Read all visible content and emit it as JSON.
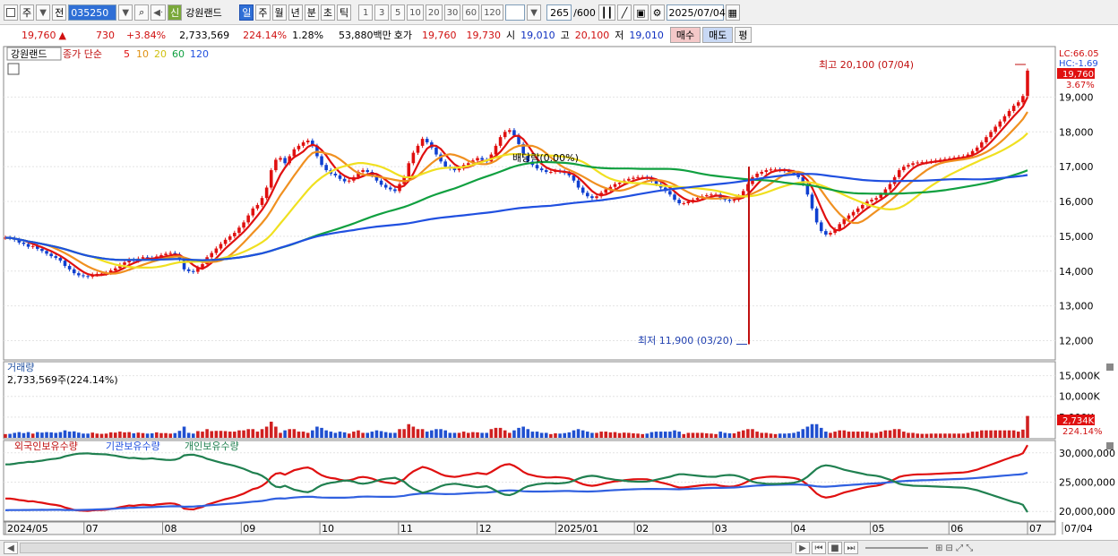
{
  "toolbar": {
    "market_label": "주",
    "prev_label": "전",
    "code": "035250",
    "badge": "신",
    "name": "강원랜드",
    "periods": [
      "일",
      "주",
      "월",
      "년",
      "분",
      "초",
      "틱"
    ],
    "active_period": "일",
    "intervals": [
      "1",
      "3",
      "5",
      "10",
      "20",
      "30",
      "60",
      "120"
    ],
    "count": "265",
    "count_total": "/600",
    "date": "2025/07/04"
  },
  "quote": {
    "price": "19,760",
    "change_arrow": "▲",
    "change": "730",
    "change_pct": "+3.84%",
    "volume": "2,733,569",
    "volume_ratio": "224.14%",
    "turnover": "1.28%",
    "amount": "53,880백만",
    "bid_label": "호가",
    "ask_price": "19,760",
    "bid_price": "19,730",
    "open_label": "시",
    "open": "19,010",
    "high_label": "고",
    "high": "20,100",
    "low_label": "저",
    "low": "19,010",
    "buy_label": "매수",
    "sell_label": "매도",
    "eval_label": "평"
  },
  "chart_data": [
    {
      "type": "candlestick",
      "title_tag": "강원랜드",
      "legend": {
        "label": "종가 단순",
        "periods": [
          "5",
          "10",
          "20",
          "60",
          "120"
        ],
        "colors": [
          "#e01010",
          "#f09020",
          "#f0e020",
          "#10a040",
          "#2050e0"
        ]
      },
      "y_ticks": [
        12000,
        13000,
        14000,
        15000,
        16000,
        17000,
        18000,
        19000
      ],
      "y_tick_labels": [
        "12,000",
        "13,000",
        "14,000",
        "15,000",
        "16,000",
        "17,000",
        "18,000",
        "19,000"
      ],
      "ylim": [
        11500,
        20400
      ],
      "lc_label": "LC:66.05",
      "hc_label": "HC:-1.69",
      "last_price_label": "19,760",
      "last_change_label": "3.67%",
      "high_annotation": "최고 20,100 (07/04)",
      "low_annotation": "최저 11,900 (03/20)",
      "event_annotation": "배당락(0.00%)",
      "close_series": [
        14960,
        14950,
        14900,
        14820,
        14780,
        14700,
        14720,
        14640,
        14580,
        14500,
        14430,
        14380,
        14300,
        14150,
        14050,
        13940,
        13880,
        13860,
        13840,
        13900,
        13920,
        13930,
        13950,
        14020,
        14080,
        14180,
        14250,
        14330,
        14300,
        14360,
        14400,
        14380,
        14350,
        14420,
        14460,
        14500,
        14520,
        14480,
        14350,
        14050,
        14000,
        13980,
        14100,
        14200,
        14400,
        14520,
        14650,
        14780,
        14900,
        15000,
        15100,
        15250,
        15400,
        15600,
        15800,
        15900,
        16100,
        16400,
        16900,
        17200,
        17250,
        17100,
        17300,
        17500,
        17600,
        17700,
        17750,
        17600,
        17300,
        17050,
        16900,
        16800,
        16750,
        16650,
        16580,
        16600,
        16700,
        16850,
        16900,
        16850,
        16750,
        16600,
        16480,
        16400,
        16350,
        16300,
        16500,
        16700,
        17100,
        17400,
        17600,
        17800,
        17700,
        17550,
        17350,
        17150,
        17000,
        16950,
        16900,
        16950,
        17050,
        17100,
        17180,
        17250,
        17200,
        17150,
        17350,
        17600,
        17850,
        18000,
        18050,
        17900,
        17650,
        17350,
        17150,
        17050,
        16950,
        16900,
        16850,
        16850,
        16880,
        16860,
        16820,
        16750,
        16600,
        16400,
        16250,
        16150,
        16100,
        16150,
        16250,
        16350,
        16420,
        16500,
        16540,
        16600,
        16650,
        16680,
        16700,
        16700,
        16680,
        16600,
        16500,
        16400,
        16300,
        16200,
        16050,
        15950,
        15950,
        16000,
        16050,
        16100,
        16150,
        16180,
        16200,
        16200,
        16100,
        16050,
        16020,
        16050,
        16150,
        16300,
        16500,
        16700,
        16800,
        16850,
        16900,
        16920,
        16920,
        16900,
        16880,
        16850,
        16800,
        16700,
        16500,
        16200,
        15800,
        15400,
        15150,
        15050,
        15100,
        15200,
        15350,
        15500,
        15600,
        15700,
        15800,
        15900,
        16000,
        16050,
        16100,
        16200,
        16350,
        16500,
        16700,
        16900,
        17000,
        17050,
        17100,
        17120,
        17130,
        17140,
        17160,
        17180,
        17200,
        17220,
        17240,
        17260,
        17280,
        17300,
        17350,
        17450,
        17550,
        17700,
        17850,
        18000,
        18150,
        18300,
        18450,
        18600,
        18750,
        18850,
        19030,
        19760
      ],
      "ma_series": {
        "ma5": [
          14960,
          14950,
          14900,
          14820,
          14780,
          14700,
          14720,
          14640,
          14580,
          14500,
          14430,
          14380,
          14300,
          14150,
          14050,
          13940,
          13880,
          13860,
          13840,
          13900,
          13920,
          13930,
          13950,
          14020,
          14080,
          14180,
          14250,
          14330,
          14300,
          14360,
          14400,
          14380,
          14350,
          14420,
          14460,
          14500,
          14520,
          14480,
          14350,
          14050,
          14000,
          13980,
          14100,
          14200,
          14400,
          14520,
          14650,
          14780,
          14900,
          15000,
          15100,
          15250,
          15400,
          15600,
          15800,
          15900,
          16100,
          16400,
          16900,
          17200,
          17250,
          17100,
          17300,
          17500,
          17600,
          17700,
          17750,
          17600,
          17300,
          17050,
          16900,
          16800,
          16750,
          16650,
          16580,
          16600,
          16700,
          16850,
          16900,
          16850,
          16750,
          16600,
          16480,
          16400,
          16350,
          16300,
          16500,
          16700,
          17100,
          17400,
          17600,
          17800,
          17700,
          17550,
          17350,
          17150,
          17000,
          16950,
          16900,
          16950,
          17050,
          17100,
          17180,
          17250,
          17200,
          17150,
          17350,
          17600,
          17850,
          18000,
          18050,
          17900,
          17650,
          17350,
          17150,
          17050,
          16950,
          16900,
          16850,
          16850,
          16880,
          16860,
          16820,
          16750,
          16600,
          16400,
          16250,
          16150,
          16100,
          16150,
          16250,
          16350,
          16420,
          16500,
          16540,
          16600,
          16650,
          16680,
          16700,
          16700,
          16680,
          16600,
          16500,
          16400,
          16300,
          16200,
          16050,
          15950,
          15950,
          16000,
          16050,
          16100,
          16150,
          16180,
          16200,
          16200,
          16100,
          16050,
          16020,
          16050,
          16150,
          16300,
          16500,
          16700,
          16800,
          16850,
          16900,
          16920,
          16920,
          16900,
          16880,
          16850,
          16800,
          16700,
          16500,
          16200,
          15800,
          15400,
          15150,
          15050,
          15100,
          15200,
          15350,
          15500,
          15600,
          15700,
          15800,
          15900,
          16000,
          16050,
          16100,
          16200,
          16350,
          16500,
          16700,
          16900,
          17000,
          17050,
          17100,
          17120,
          17130,
          17140,
          17160,
          17180,
          17200,
          17220,
          17240,
          17260,
          17280,
          17300,
          17350,
          17450,
          17550,
          17700,
          17850,
          18000,
          18150,
          18300,
          18450,
          18600,
          18750,
          18850,
          19030,
          19760
        ]
      }
    },
    {
      "type": "bar",
      "title": "거래량",
      "value_label": "2,733,569주(224.14%)",
      "y_ticks": [
        5000,
        10000,
        15000
      ],
      "y_tick_labels": [
        "5,000K",
        "10,000K",
        "15,000K"
      ],
      "ylim": [
        0,
        17500
      ],
      "last_label": "2,734K",
      "last_pct_label": "224.14%",
      "units": "K"
    },
    {
      "type": "line",
      "series_names": [
        "외국인보유수량",
        "기관보유수량",
        "개인보유수량"
      ],
      "series_colors": [
        "#e01010",
        "#3060e0",
        "#208050"
      ],
      "y_ticks": [
        20000000,
        25000000,
        30000000
      ],
      "y_tick_labels": [
        "20,000,000",
        "25,000,000",
        "30,000,000"
      ],
      "ylim": [
        18500000,
        31500000
      ],
      "x_tick_labels": [
        "2024/05",
        "07",
        "08",
        "09",
        "10",
        "11",
        "12",
        "2025/01",
        "02",
        "03",
        "04",
        "05",
        "06",
        "07",
        "07/04"
      ]
    }
  ],
  "bottom": {
    "buttons": [
      "◀",
      "▶",
      "⏮",
      "■",
      "⏭"
    ]
  }
}
